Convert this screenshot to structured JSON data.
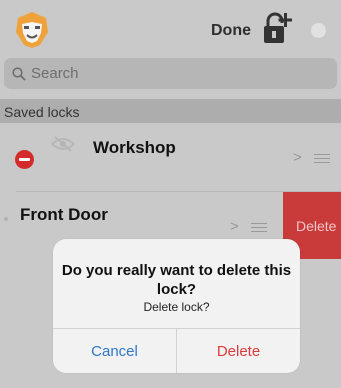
{
  "navbar": {
    "logo_icon": "lion-logo-icon",
    "done_label": "Done",
    "add_lock_icon": "lock-plus-icon"
  },
  "search": {
    "placeholder": "Search",
    "icon": "search-icon"
  },
  "section": {
    "title": "Saved locks"
  },
  "locks": [
    {
      "name": "Workshop",
      "editing": true
    },
    {
      "name": "Front Door",
      "swiped": true
    }
  ],
  "swipe_action": {
    "label": "Delete"
  },
  "dialog": {
    "title": "Do you really want to delete this lock?",
    "message": "Delete lock?",
    "cancel_label": "Cancel",
    "delete_label": "Delete"
  },
  "colors": {
    "destructive": "#dd3b3b",
    "accent": "#2f78c8",
    "logo_orange": "#f0a23a"
  }
}
